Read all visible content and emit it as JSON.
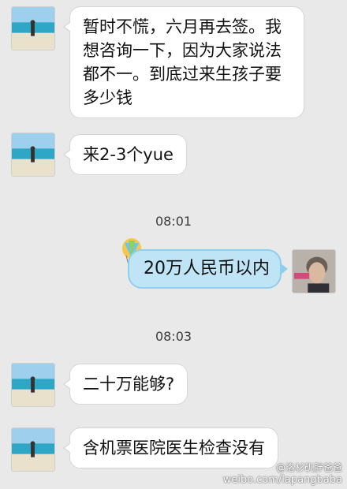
{
  "messages": [
    {
      "text": "暂时不慌，六月再去签。我想咨询一下，因为大家说法都不一。到底过来生孩子要多少钱"
    },
    {
      "text": "来2-3个yue"
    },
    {
      "time": "08:01"
    },
    {
      "text": "20万人民币以内"
    },
    {
      "time": "08:03"
    },
    {
      "text": "二十万能够?"
    },
    {
      "text": "含机票医院医生检查没有"
    }
  ],
  "watermark": {
    "handle": "@洛杉矶胖爸爸",
    "url": "weibo.com/lapangbaba"
  },
  "colors": {
    "background": "#e9e9e9",
    "received_bubble": "#ffffff",
    "sent_bubble": "#bfe4f6"
  },
  "icons": {
    "balloon": "hot-air-balloon-icon",
    "weibo": "weibo-logo-icon"
  }
}
